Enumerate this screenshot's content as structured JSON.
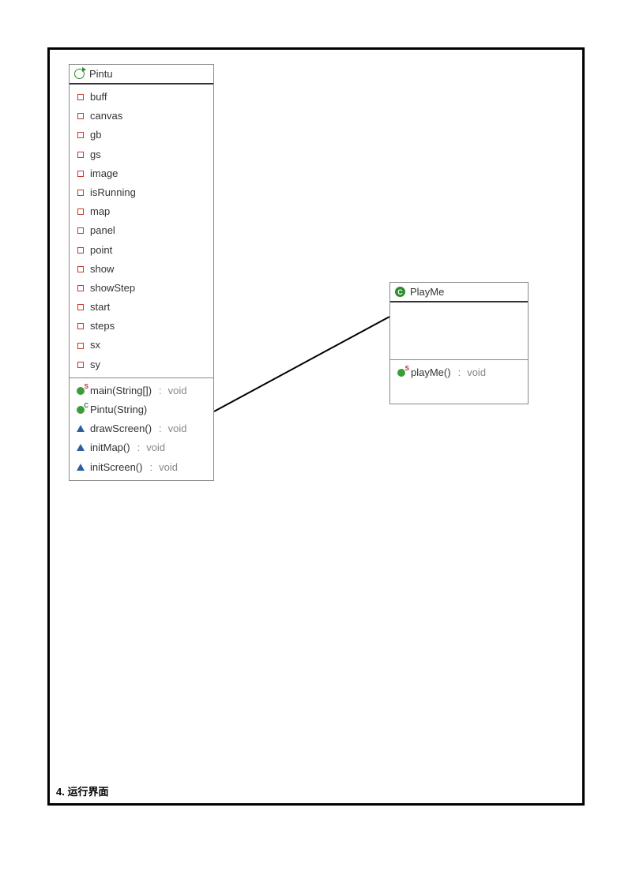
{
  "caption": "4. 运行界面",
  "classes": {
    "pintu": {
      "name": "Pintu",
      "fields": [
        "buff",
        "canvas",
        "gb",
        "gs",
        "image",
        "isRunning",
        "map",
        "panel",
        "point",
        "show",
        "showStep",
        "start",
        "steps",
        "sx",
        "sy"
      ],
      "methods": [
        {
          "kind": "static",
          "sig": "main(String[])",
          "ret": "void"
        },
        {
          "kind": "constructor",
          "sig": "Pintu(String)",
          "ret": ""
        },
        {
          "kind": "default",
          "sig": "drawScreen()",
          "ret": "void"
        },
        {
          "kind": "default",
          "sig": "initMap()",
          "ret": "void"
        },
        {
          "kind": "default",
          "sig": "initScreen()",
          "ret": "void"
        }
      ]
    },
    "playme": {
      "name": "PlayMe",
      "methods": [
        {
          "kind": "static",
          "sig": "playMe()",
          "ret": "void"
        }
      ]
    }
  },
  "chart_data": {
    "type": "uml-class-diagram",
    "classes": [
      {
        "name": "Pintu",
        "stereotype": "runnable-class",
        "fields": [
          "buff",
          "canvas",
          "gb",
          "gs",
          "image",
          "isRunning",
          "map",
          "panel",
          "point",
          "show",
          "showStep",
          "start",
          "steps",
          "sx",
          "sy"
        ],
        "methods": [
          {
            "name": "main",
            "params": [
              "String[]"
            ],
            "return": "void",
            "modifiers": [
              "static",
              "public"
            ]
          },
          {
            "name": "Pintu",
            "params": [
              "String"
            ],
            "return": null,
            "modifiers": [
              "constructor",
              "public"
            ]
          },
          {
            "name": "drawScreen",
            "params": [],
            "return": "void",
            "modifiers": [
              "package-private"
            ]
          },
          {
            "name": "initMap",
            "params": [],
            "return": "void",
            "modifiers": [
              "package-private"
            ]
          },
          {
            "name": "initScreen",
            "params": [],
            "return": "void",
            "modifiers": [
              "package-private"
            ]
          }
        ]
      },
      {
        "name": "PlayMe",
        "stereotype": "class",
        "fields": [],
        "methods": [
          {
            "name": "playMe",
            "params": [],
            "return": "void",
            "modifiers": [
              "static",
              "public"
            ]
          }
        ]
      }
    ],
    "relationships": [
      {
        "from": "Pintu",
        "to": "PlayMe",
        "type": "association"
      }
    ]
  }
}
